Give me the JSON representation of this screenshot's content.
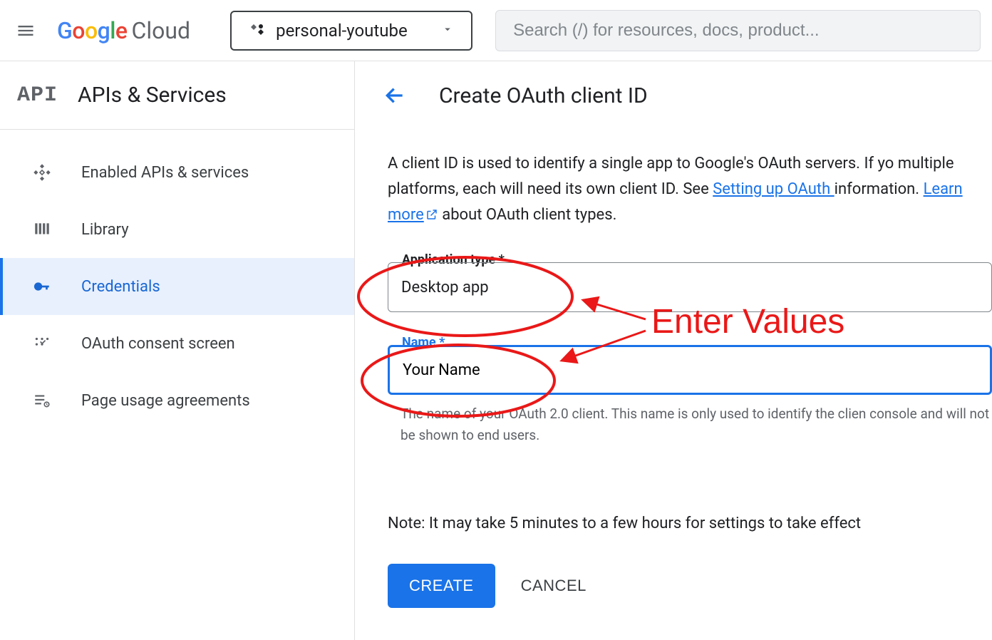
{
  "header": {
    "logo_brand": "Google",
    "logo_product": "Cloud",
    "project_name": "personal-youtube",
    "search_placeholder": "Search (/) for resources, docs, product..."
  },
  "sidebar": {
    "badge": "API",
    "title": "APIs & Services",
    "items": [
      {
        "label": "Enabled APIs & services",
        "icon": "diamond-grid-icon"
      },
      {
        "label": "Library",
        "icon": "library-icon"
      },
      {
        "label": "Credentials",
        "icon": "key-icon"
      },
      {
        "label": "OAuth consent screen",
        "icon": "consent-icon"
      },
      {
        "label": "Page usage agreements",
        "icon": "agreement-icon"
      }
    ]
  },
  "main": {
    "heading": "Create OAuth client ID",
    "description_p1": "A client ID is used to identify a single app to Google's OAuth servers. If yo",
    "description_p2": "multiple platforms, each will need its own client ID. See ",
    "link_setting": "Setting up OAuth ",
    "description_p3": "information. ",
    "link_learn": "Learn more",
    "description_p4": " about OAuth client types.",
    "field_app_type_label": "Application type *",
    "field_app_type_value": "Desktop app",
    "field_name_label": "Name *",
    "field_name_value": "Your Name",
    "helper_text": "The name of your OAuth 2.0 client. This name is only used to identify the clien console and will not be shown to end users.",
    "note": "Note: It may take 5 minutes to a few hours for settings to take effect",
    "create_label": "CREATE",
    "cancel_label": "CANCEL"
  },
  "annotation": {
    "text": "Enter Values"
  }
}
